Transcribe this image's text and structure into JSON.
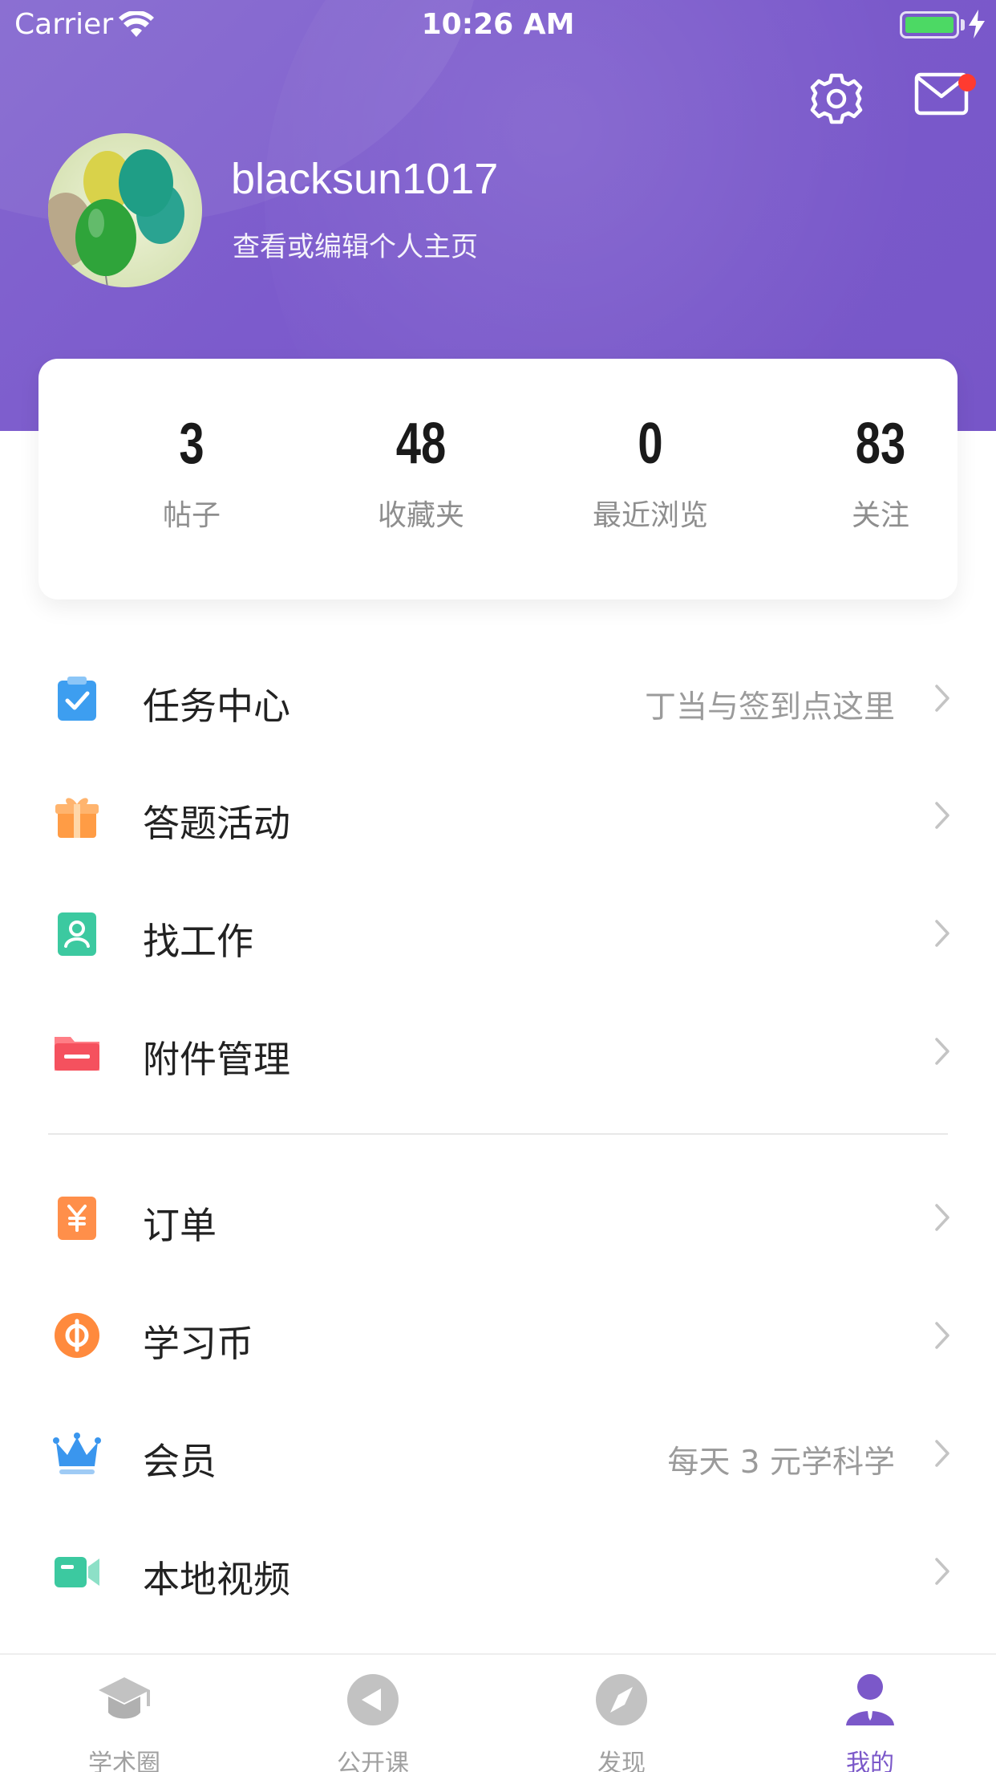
{
  "status_bar": {
    "carrier": "Carrier",
    "time": "10:26 AM"
  },
  "profile": {
    "username": "blacksun1017",
    "edit_link": "查看或编辑个人主页"
  },
  "stats": [
    {
      "value": "3",
      "label": "帖子"
    },
    {
      "value": "48",
      "label": "收藏夹"
    },
    {
      "value": "0",
      "label": "最近浏览"
    },
    {
      "value": "83",
      "label": "关注"
    }
  ],
  "menu": {
    "group1": [
      {
        "label": "任务中心",
        "hint": "丁当与签到点这里",
        "icon": "clipboard-check-icon"
      },
      {
        "label": "答题活动",
        "hint": "",
        "icon": "gift-icon"
      },
      {
        "label": "找工作",
        "hint": "",
        "icon": "person-badge-icon"
      },
      {
        "label": "附件管理",
        "hint": "",
        "icon": "folder-icon"
      }
    ],
    "group2": [
      {
        "label": "订单",
        "hint": "",
        "icon": "yen-order-icon"
      },
      {
        "label": "学习币",
        "hint": "",
        "icon": "coin-icon"
      },
      {
        "label": "会员",
        "hint": "每天 3 元学科学",
        "icon": "crown-icon"
      },
      {
        "label": "本地视频",
        "hint": "",
        "icon": "video-camera-icon"
      }
    ]
  },
  "tab_bar": [
    {
      "label": "学术圈",
      "icon": "graduation-cap-icon",
      "active": false
    },
    {
      "label": "公开课",
      "icon": "play-circle-icon",
      "active": false
    },
    {
      "label": "发现",
      "icon": "compass-icon",
      "active": false
    },
    {
      "label": "我的",
      "icon": "user-icon",
      "active": true
    }
  ],
  "colors": {
    "header_purple": "#7c5bcc",
    "accent_purple": "#7b58c9",
    "notification_red": "#ff3b30",
    "battery_green": "#4cd964"
  }
}
